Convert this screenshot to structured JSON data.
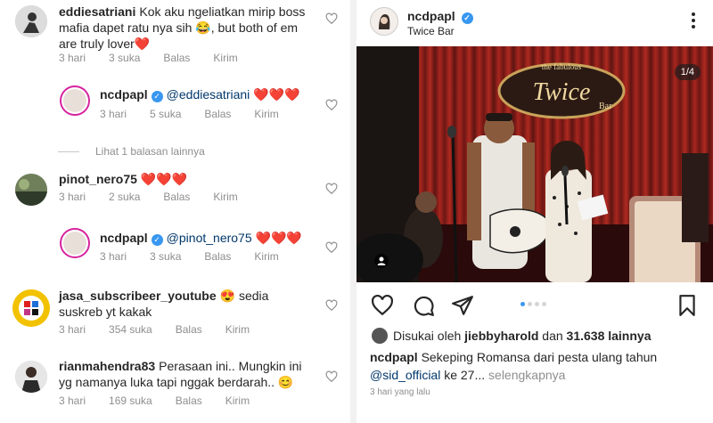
{
  "comments": [
    {
      "username": "eddiesatriani",
      "text": "Kok aku ngeliatkan mirip boss mafia dapet ratu nya sih 😂, but both of em are truly lover❤️",
      "time": "3 hari",
      "likes": "3 suka",
      "reply": "Balas",
      "send": "Kirim"
    },
    {
      "username": "ncdpapl",
      "mention": "@eddiesatriani",
      "text": "❤️❤️❤️",
      "time": "3 hari",
      "likes": "5 suka",
      "reply": "Balas",
      "send": "Kirim"
    },
    {
      "username": "pinot_nero75",
      "text": "❤️❤️❤️",
      "time": "3 hari",
      "likes": "2 suka",
      "reply": "Balas",
      "send": "Kirim"
    },
    {
      "username": "ncdpapl",
      "mention": "@pinot_nero75",
      "text": "❤️❤️❤️",
      "time": "3 hari",
      "likes": "3 suka",
      "reply": "Balas",
      "send": "Kirim"
    },
    {
      "username": "jasa_subscribeer_youtube",
      "text": "😍 sedia suskreb yt kakak",
      "time": "3 hari",
      "likes": "354 suka",
      "reply": "Balas",
      "send": "Kirim"
    },
    {
      "username": "rianmahendra83",
      "text": "Perasaan ini.. Mungkin ini yg namanya luka tapi nggak berdarah.. 😊",
      "time": "3 hari",
      "likes": "169 suka",
      "reply": "Balas",
      "send": "Kirim"
    }
  ],
  "view_replies": "Lihat 1 balasan lainnya",
  "post": {
    "username": "ncdpapl",
    "location": "Twice Bar",
    "counter": "1/4",
    "neon_sign": "Twice",
    "neon_top": "the fabulous",
    "neon_bar": "Bar",
    "likes_prefix": "Disukai oleh",
    "likes_user": "jiebbyharold",
    "likes_mid": "dan",
    "likes_count": "31.638 lainnya",
    "caption_user": "ncdpapl",
    "caption_text": "Sekeping Romansa dari pesta ulang tahun",
    "caption_mention": "@sid_official",
    "caption_tail": "ke 27...",
    "caption_more": "selengkapnya",
    "time": "3 hari yang lalu"
  },
  "icons": {
    "heart": "heart-outline-icon",
    "comment": "comment-icon",
    "share": "send-icon",
    "save": "bookmark-icon",
    "verified": "verified-badge-icon",
    "more": "more-vertical-icon",
    "tag": "user-tag-icon"
  },
  "colors": {
    "accent": "#3897f0",
    "mention": "#00376b",
    "muted": "#8e8e8e"
  }
}
